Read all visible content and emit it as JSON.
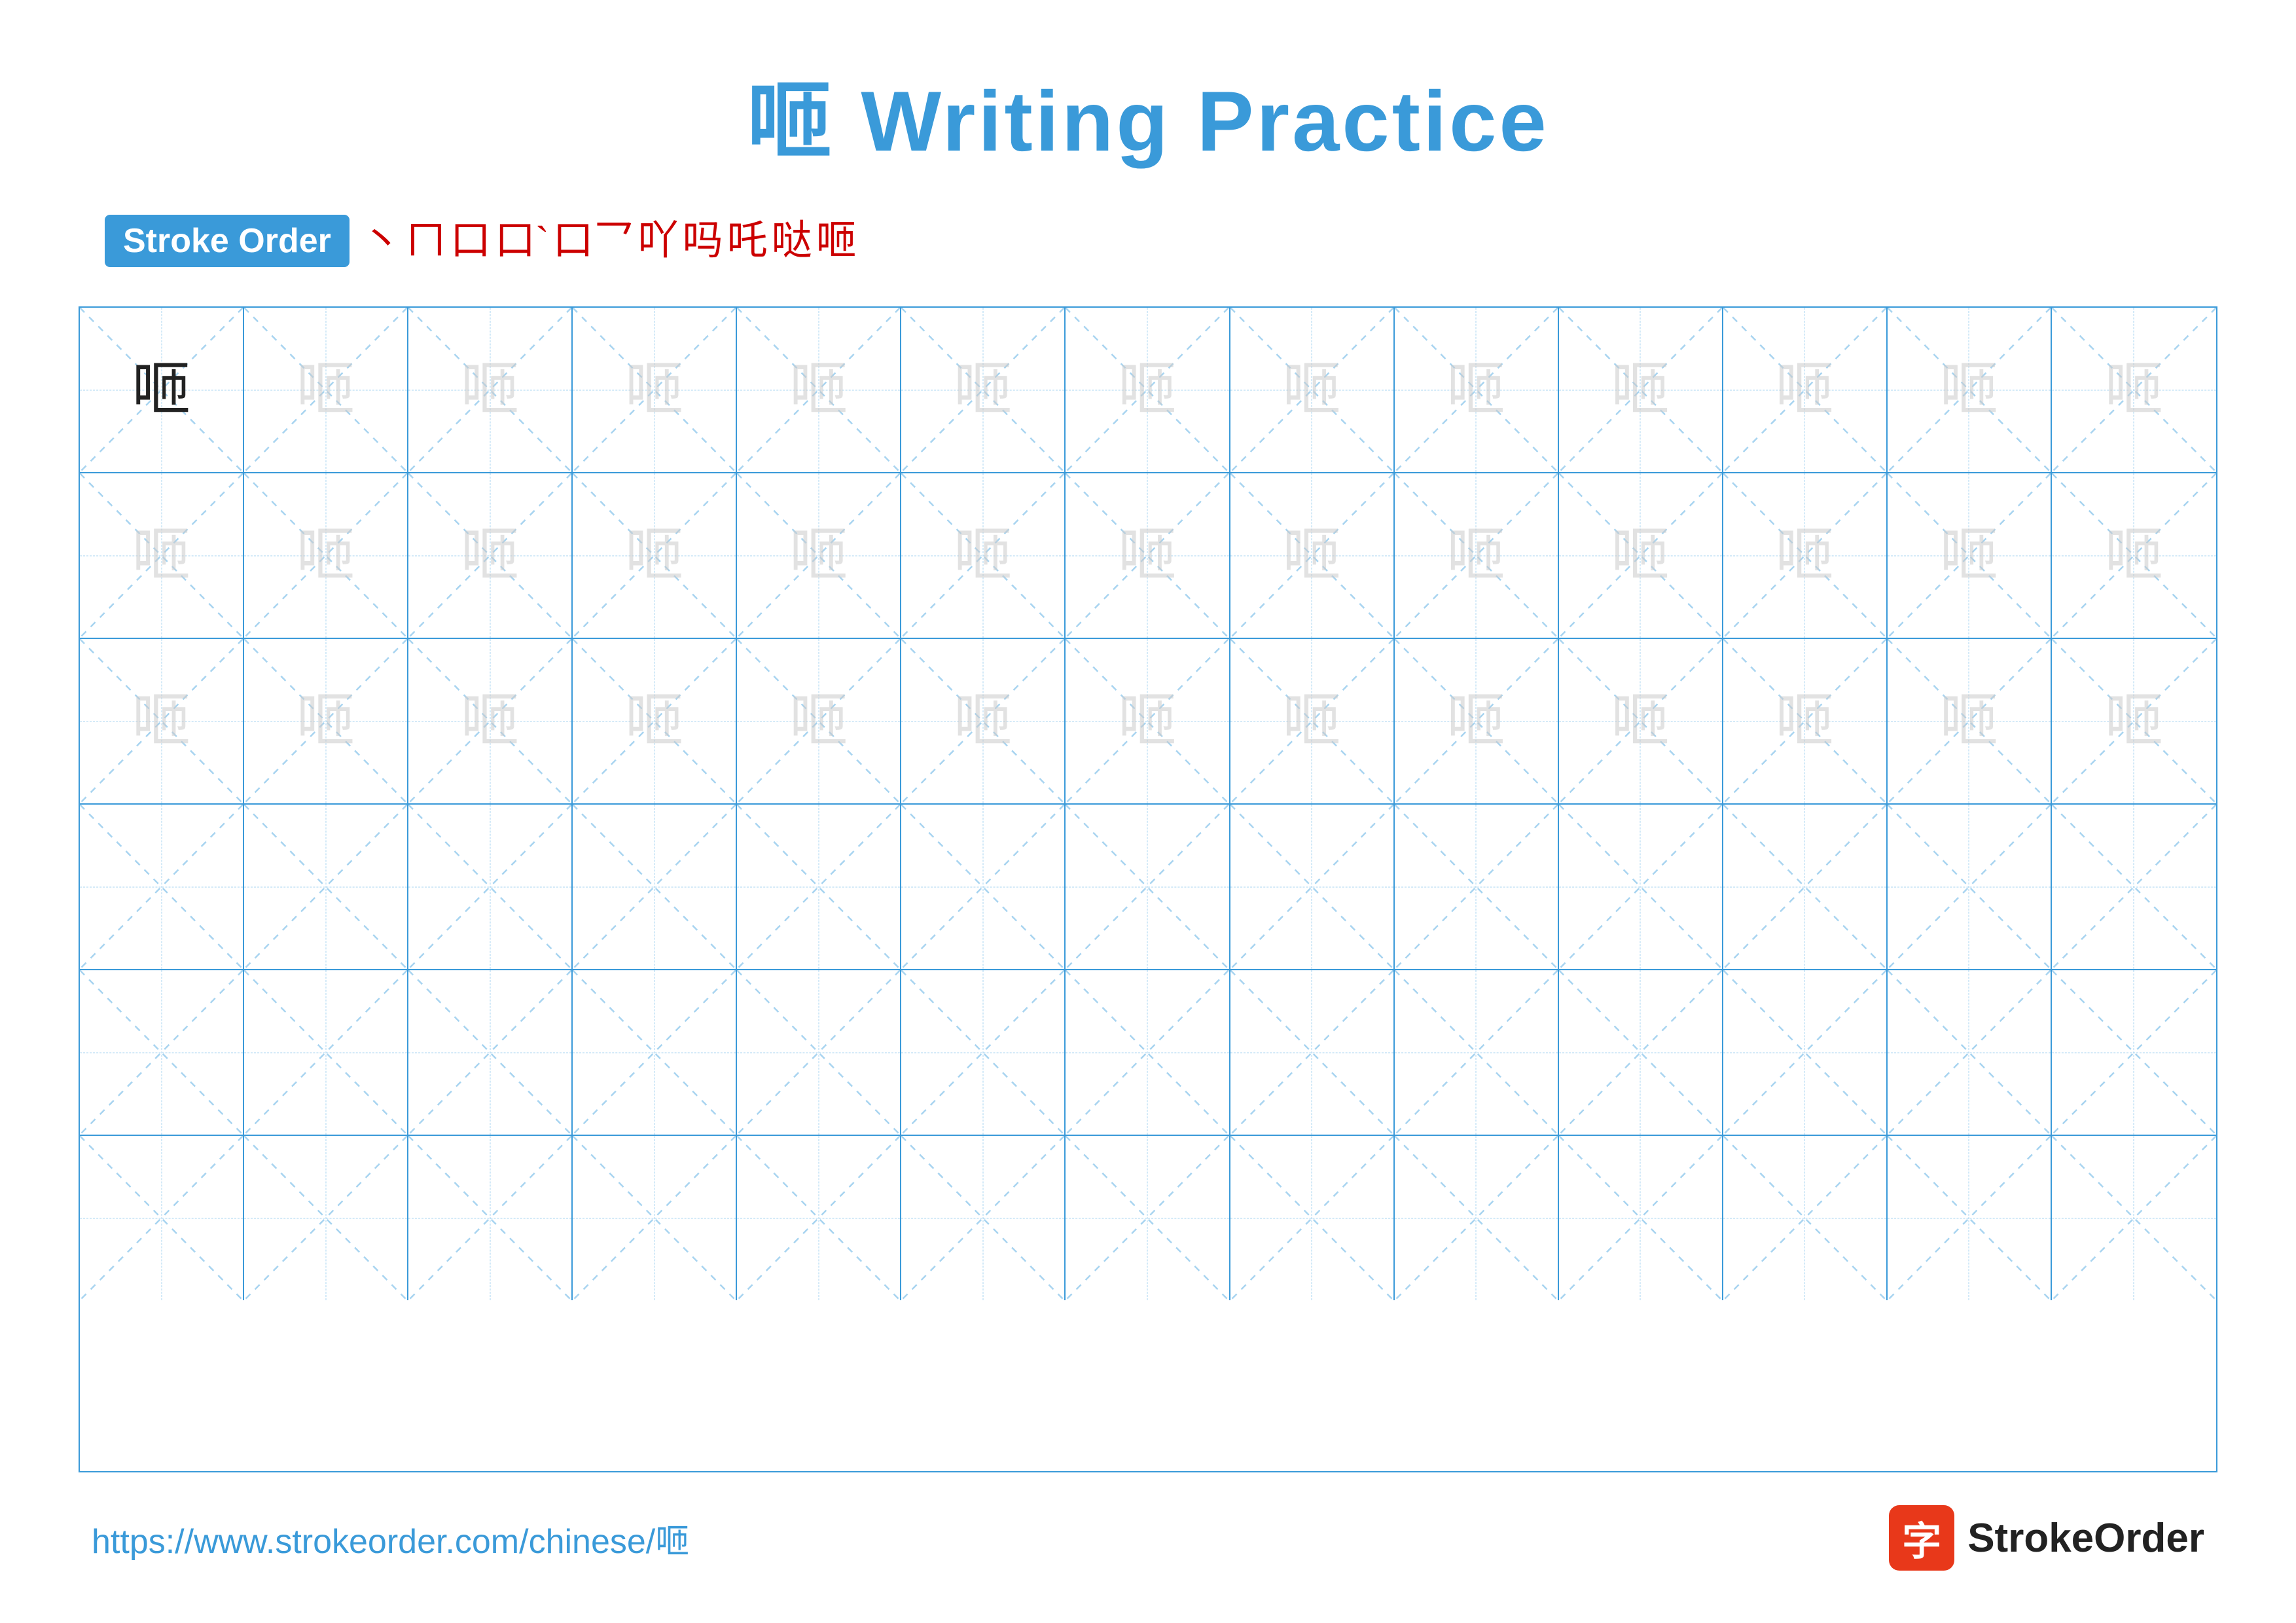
{
  "title": "咂 Writing Practice",
  "char": "咂",
  "stroke_order_label": "Stroke Order",
  "stroke_order_chars": [
    "丶",
    "𠃊",
    "口",
    "口`",
    "口乛",
    "𠁁丶",
    "𠁁丶㇀",
    "𠁁丶㇀ˇ",
    "𠁁丶㇀ˇ㇏",
    "咂"
  ],
  "stroke_seq_display": [
    "丶",
    "ㄇ",
    "口",
    "口`",
    "口乛",
    "𠄌丶",
    "𠄌丶㇀",
    "𠄌丶㇀ˇ",
    "咂ˇ",
    "咂"
  ],
  "rows": [
    {
      "type": "practice",
      "first_solid": true
    },
    {
      "type": "practice",
      "first_solid": false
    },
    {
      "type": "practice",
      "first_solid": false
    },
    {
      "type": "empty"
    },
    {
      "type": "empty"
    },
    {
      "type": "empty"
    }
  ],
  "footer_url": "https://www.strokeorder.com/chinese/咂",
  "footer_logo_char": "字",
  "footer_logo_text": "StrokeOrder"
}
